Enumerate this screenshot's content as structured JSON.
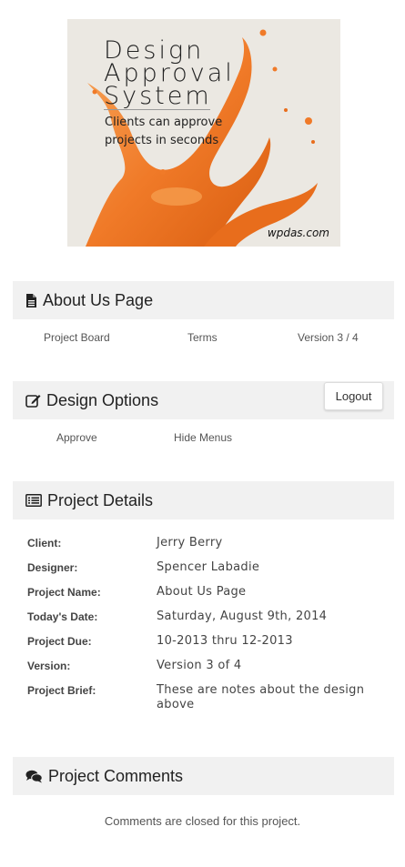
{
  "banner": {
    "title_line1": "Design",
    "title_line2": "Approval",
    "title_line3": "System",
    "tagline_line1": "Clients can approve",
    "tagline_line2": "projects in seconds",
    "site": "wpdas.com"
  },
  "about_panel": {
    "title": "About Us Page",
    "icon": "file-icon",
    "links": [
      "Project Board",
      "Terms",
      "Version 3 / 4"
    ]
  },
  "design_panel": {
    "title": "Design Options",
    "icon": "edit-icon",
    "logout_label": "Logout",
    "links": [
      "Approve",
      "Hide Menus"
    ]
  },
  "details_panel": {
    "title": "Project Details",
    "icon": "list-icon",
    "rows": [
      {
        "label": "Client:",
        "value": "Jerry Berry"
      },
      {
        "label": "Designer:",
        "value": "Spencer Labadie"
      },
      {
        "label": "Project Name:",
        "value": "About Us Page"
      },
      {
        "label": "Today's Date:",
        "value": "Saturday, August 9th, 2014"
      },
      {
        "label": "Project Due:",
        "value": "10-2013 thru 12-2013"
      },
      {
        "label": "Version:",
        "value": "Version 3 of 4"
      },
      {
        "label": "Project Brief:",
        "value": "These are notes about the design above"
      }
    ]
  },
  "comments_panel": {
    "title": "Project Comments",
    "icon": "comments-icon",
    "closed_text": "Comments are closed for this project."
  },
  "colors": {
    "panel_bg": "#f1f1f1",
    "splash_orange": "#f07a28"
  }
}
